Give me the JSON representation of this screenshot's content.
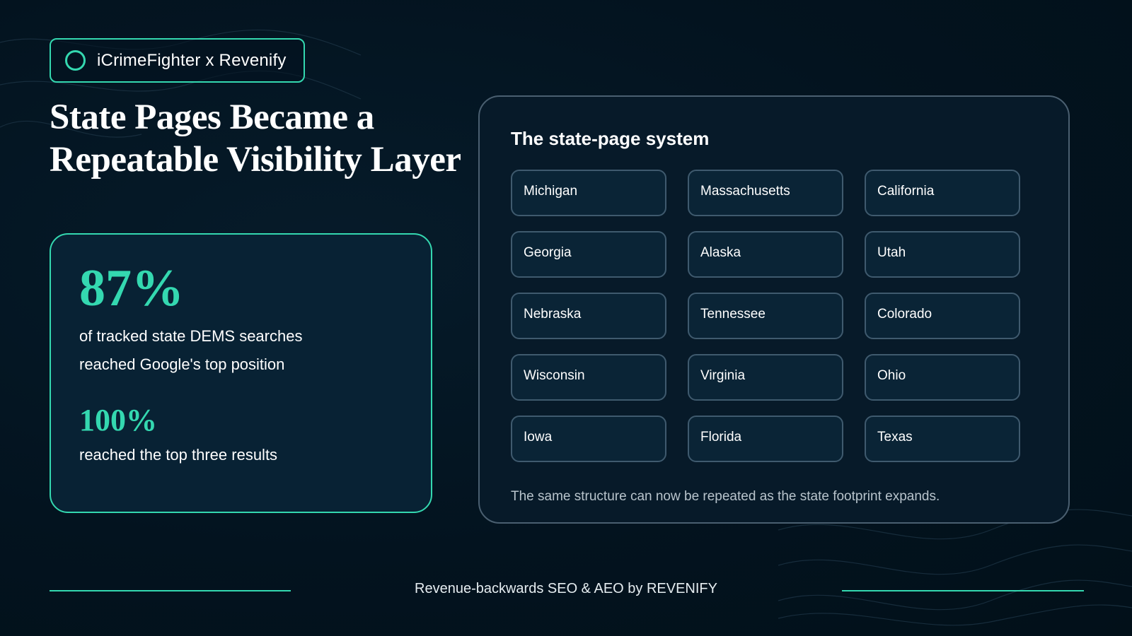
{
  "brand": {
    "label": "iCrimeFighter x Revenify"
  },
  "headline": {
    "line1": "State Pages Became a",
    "line2": "Repeatable Visibility Layer"
  },
  "stats": {
    "primary_value": "87%",
    "primary_desc_line1": "of tracked state DEMS searches",
    "primary_desc_line2": "reached Google's top position",
    "secondary_value": "100%",
    "secondary_desc": "reached the top three results"
  },
  "system": {
    "title": "The state-page system",
    "states": [
      "Michigan",
      "Massachusetts",
      "California",
      "Georgia",
      "Alaska",
      "Utah",
      "Nebraska",
      "Tennessee",
      "Colorado",
      "Wisconsin",
      "Virginia",
      "Ohio",
      "Iowa",
      "Florida",
      "Texas"
    ],
    "note": "The same structure can now be repeated as the state footprint expands."
  },
  "footer": {
    "text": "Revenue-backwards SEO & AEO by REVENIFY"
  },
  "colors": {
    "accent": "#34d8b0",
    "background": "#03131f",
    "card": "#082234"
  }
}
